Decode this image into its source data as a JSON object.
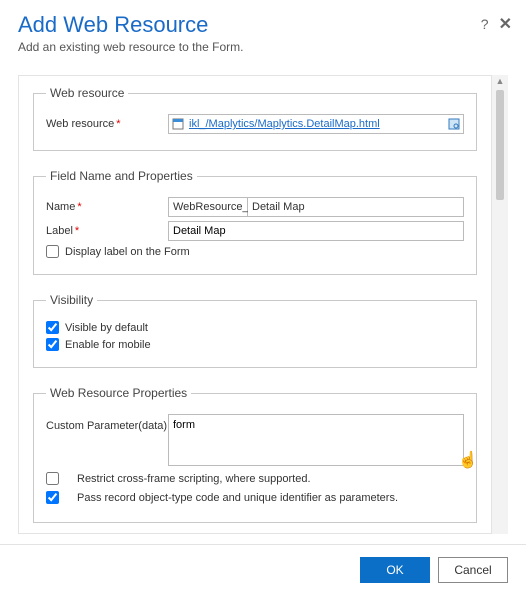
{
  "header": {
    "title": "Add Web Resource",
    "subtitle": "Add an existing web resource to the Form."
  },
  "fieldsets": {
    "web_resource": {
      "legend": "Web resource",
      "label": "Web resource",
      "value": "ikl_/Maplytics/Maplytics.DetailMap.html"
    },
    "field_name": {
      "legend": "Field Name and Properties",
      "name_label": "Name",
      "name_prefix": "WebResource_",
      "name_value": "Detail Map",
      "label_label": "Label",
      "label_value": "Detail Map",
      "display_label_text": "Display label on the Form",
      "display_label_checked": false
    },
    "visibility": {
      "legend": "Visibility",
      "visible_text": "Visible by default",
      "visible_checked": true,
      "mobile_text": "Enable for mobile",
      "mobile_checked": true
    },
    "properties": {
      "legend": "Web Resource Properties",
      "custom_param_label": "Custom Parameter(data)",
      "custom_param_value": "form",
      "restrict_text": "Restrict cross-frame scripting, where supported.",
      "restrict_checked": false,
      "pass_record_text": "Pass record object-type code and unique identifier as parameters.",
      "pass_record_checked": true
    }
  },
  "footer": {
    "ok": "OK",
    "cancel": "Cancel"
  }
}
